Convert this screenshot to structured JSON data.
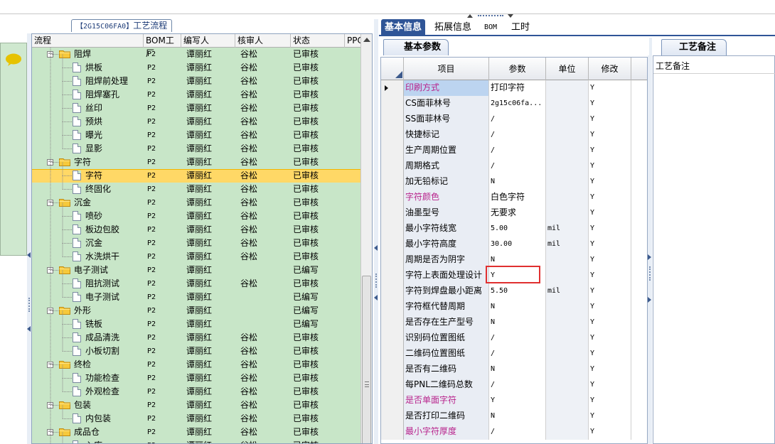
{
  "tree_panel": {
    "title_code": "【2G15C06FA0】",
    "title_text": "工艺流程",
    "columns": [
      "流程",
      "BOM工厂",
      "编写人",
      "核审人",
      "状态",
      "PPC"
    ],
    "rows": [
      {
        "name": "阻焊",
        "factory": "P2",
        "writer": "谭丽红",
        "reviewer": "谷松",
        "status": "已审核",
        "folder": true
      },
      {
        "name": "烘板",
        "factory": "P2",
        "writer": "谭丽红",
        "reviewer": "谷松",
        "status": "已审核"
      },
      {
        "name": "阻焊前处理",
        "factory": "P2",
        "writer": "谭丽红",
        "reviewer": "谷松",
        "status": "已审核"
      },
      {
        "name": "阻焊塞孔",
        "factory": "P2",
        "writer": "谭丽红",
        "reviewer": "谷松",
        "status": "已审核"
      },
      {
        "name": "丝印",
        "factory": "P2",
        "writer": "谭丽红",
        "reviewer": "谷松",
        "status": "已审核"
      },
      {
        "name": "预烘",
        "factory": "P2",
        "writer": "谭丽红",
        "reviewer": "谷松",
        "status": "已审核"
      },
      {
        "name": "曝光",
        "factory": "P2",
        "writer": "谭丽红",
        "reviewer": "谷松",
        "status": "已审核"
      },
      {
        "name": "显影",
        "factory": "P2",
        "writer": "谭丽红",
        "reviewer": "谷松",
        "status": "已审核"
      },
      {
        "name": "字符",
        "factory": "P2",
        "writer": "谭丽红",
        "reviewer": "谷松",
        "status": "已审核",
        "folder": true
      },
      {
        "name": "字符",
        "factory": "P2",
        "writer": "谭丽红",
        "reviewer": "谷松",
        "status": "已审核",
        "selected": true
      },
      {
        "name": "终固化",
        "factory": "P2",
        "writer": "谭丽红",
        "reviewer": "谷松",
        "status": "已审核"
      },
      {
        "name": "沉金",
        "factory": "P2",
        "writer": "谭丽红",
        "reviewer": "谷松",
        "status": "已审核",
        "folder": true
      },
      {
        "name": "喷砂",
        "factory": "P2",
        "writer": "谭丽红",
        "reviewer": "谷松",
        "status": "已审核"
      },
      {
        "name": "板边包胶",
        "factory": "P2",
        "writer": "谭丽红",
        "reviewer": "谷松",
        "status": "已审核"
      },
      {
        "name": "沉金",
        "factory": "P2",
        "writer": "谭丽红",
        "reviewer": "谷松",
        "status": "已审核"
      },
      {
        "name": "水洗烘干",
        "factory": "P2",
        "writer": "谭丽红",
        "reviewer": "谷松",
        "status": "已审核"
      },
      {
        "name": "电子测试",
        "factory": "P2",
        "writer": "谭丽红",
        "reviewer": "",
        "status": "已编写",
        "folder": true
      },
      {
        "name": "阻抗测试",
        "factory": "P2",
        "writer": "谭丽红",
        "reviewer": "谷松",
        "status": "已审核"
      },
      {
        "name": "电子测试",
        "factory": "P2",
        "writer": "谭丽红",
        "reviewer": "",
        "status": "已编写"
      },
      {
        "name": "外形",
        "factory": "P2",
        "writer": "谭丽红",
        "reviewer": "",
        "status": "已编写",
        "folder": true
      },
      {
        "name": "铣板",
        "factory": "P2",
        "writer": "谭丽红",
        "reviewer": "",
        "status": "已编写"
      },
      {
        "name": "成品清洗",
        "factory": "P2",
        "writer": "谭丽红",
        "reviewer": "谷松",
        "status": "已审核"
      },
      {
        "name": "小板切割",
        "factory": "P2",
        "writer": "谭丽红",
        "reviewer": "谷松",
        "status": "已审核"
      },
      {
        "name": "终检",
        "factory": "P2",
        "writer": "谭丽红",
        "reviewer": "谷松",
        "status": "已审核",
        "folder": true
      },
      {
        "name": "功能检查",
        "factory": "P2",
        "writer": "谭丽红",
        "reviewer": "谷松",
        "status": "已审核"
      },
      {
        "name": "外观检查",
        "factory": "P2",
        "writer": "谭丽红",
        "reviewer": "谷松",
        "status": "已审核"
      },
      {
        "name": "包装",
        "factory": "P2",
        "writer": "谭丽红",
        "reviewer": "谷松",
        "status": "已审核",
        "folder": true
      },
      {
        "name": "内包装",
        "factory": "P2",
        "writer": "谭丽红",
        "reviewer": "谷松",
        "status": "已审核"
      },
      {
        "name": "成品仓",
        "factory": "P2",
        "writer": "谭丽红",
        "reviewer": "谷松",
        "status": "已审核",
        "folder": true
      },
      {
        "name": "入库",
        "factory": "P2",
        "writer": "谭丽红",
        "reviewer": "谷松",
        "status": "已审核"
      }
    ]
  },
  "right_tabs": [
    "基本信息",
    "拓展信息",
    "BOM",
    "工时"
  ],
  "param_panel": {
    "subtab": "基本参数",
    "columns": [
      "项目",
      "参数",
      "单位",
      "修改"
    ],
    "rows": [
      {
        "item": "印刷方式",
        "param": "打印字符",
        "unit": "",
        "edit": "Y",
        "pink": true,
        "current": true
      },
      {
        "item": "CS面菲林号",
        "param": "2g15c06fa...",
        "unit": "",
        "edit": "Y"
      },
      {
        "item": "SS面菲林号",
        "param": "/",
        "unit": "",
        "edit": "Y"
      },
      {
        "item": "快捷标记",
        "param": "/",
        "unit": "",
        "edit": "Y"
      },
      {
        "item": "生产周期位置",
        "param": "/",
        "unit": "",
        "edit": "Y"
      },
      {
        "item": "周期格式",
        "param": "/",
        "unit": "",
        "edit": "Y"
      },
      {
        "item": "加无铅标记",
        "param": "N",
        "unit": "",
        "edit": "Y"
      },
      {
        "item": "字符颜色",
        "param": "白色字符",
        "unit": "",
        "edit": "Y",
        "pink": true
      },
      {
        "item": "油墨型号",
        "param": "无要求",
        "unit": "",
        "edit": "Y"
      },
      {
        "item": "最小字符线宽",
        "param": "5.00",
        "unit": "mil",
        "edit": "Y"
      },
      {
        "item": "最小字符高度",
        "param": "30.00",
        "unit": "mil",
        "edit": "Y"
      },
      {
        "item": "周期是否为阴字",
        "param": "N",
        "unit": "",
        "edit": "Y"
      },
      {
        "item": "字符上表面处理设计",
        "param": "Y",
        "unit": "",
        "edit": "Y",
        "highlight": true
      },
      {
        "item": "字符到焊盘最小距离",
        "param": "5.50",
        "unit": "mil",
        "edit": "Y"
      },
      {
        "item": "字符框代替周期",
        "param": "N",
        "unit": "",
        "edit": "Y"
      },
      {
        "item": "是否存在生产型号",
        "param": "N",
        "unit": "",
        "edit": "Y"
      },
      {
        "item": "识别码位置图纸",
        "param": "/",
        "unit": "",
        "edit": "Y"
      },
      {
        "item": "二维码位置图纸",
        "param": "/",
        "unit": "",
        "edit": "Y"
      },
      {
        "item": "是否有二维码",
        "param": "N",
        "unit": "",
        "edit": "Y"
      },
      {
        "item": "每PNL二维码总数",
        "param": "/",
        "unit": "",
        "edit": "Y"
      },
      {
        "item": "是否单面字符",
        "param": "Y",
        "unit": "",
        "edit": "Y",
        "pink": true
      },
      {
        "item": "是否打印二维码",
        "param": "N",
        "unit": "",
        "edit": "Y"
      },
      {
        "item": "最小字符厚度",
        "param": "/",
        "unit": "",
        "edit": "Y",
        "pink": true
      }
    ]
  },
  "notes_panel": {
    "tab": "工艺备注",
    "label": "工艺备注"
  },
  "colors": {
    "tree_bg": "#c8e6c8",
    "selection": "#ffd866",
    "tab_active": "#2f5597",
    "pink_label": "#b8238c",
    "highlight_box": "#e03030"
  }
}
